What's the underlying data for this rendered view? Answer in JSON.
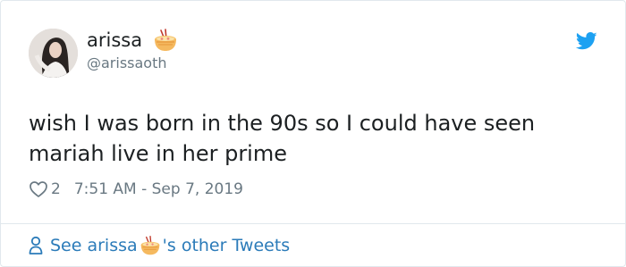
{
  "author": {
    "name": "arissa",
    "name_emoji": "ramen-bowl-icon",
    "handle": "@arissaoth"
  },
  "tweet": {
    "text": "wish I was born in the 90s so I could have seen mariah live in her prime",
    "likes": "2",
    "timestamp": "7:51 AM - Sep 7, 2019"
  },
  "footer": {
    "prefix": "See arissa",
    "suffix": "'s other Tweets"
  },
  "colors": {
    "text": "#1c2022",
    "muted": "#697882",
    "link": "#2b7bb9",
    "twitter_blue": "#1da1f2",
    "border": "#e1e8ed"
  },
  "icons": [
    "avatar",
    "ramen-bowl-icon",
    "twitter-bird-icon",
    "heart-icon",
    "person-icon"
  ]
}
